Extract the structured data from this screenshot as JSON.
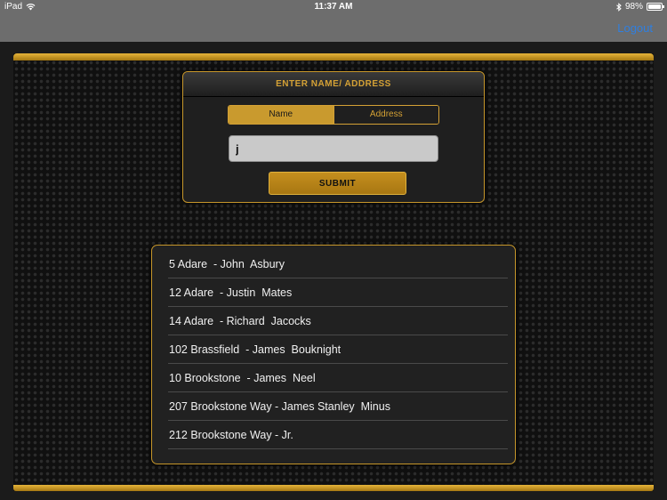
{
  "status_bar": {
    "device": "iPad",
    "time": "11:37 AM",
    "battery": "98%",
    "battery_level": 0.98,
    "icons": [
      "wifi-icon",
      "bluetooth-icon",
      "battery-icon"
    ]
  },
  "nav": {
    "logout_label": "Logout"
  },
  "form": {
    "header": "ENTER NAME/ ADDRESS",
    "tabs": [
      {
        "label": "Name",
        "selected": true
      },
      {
        "label": "Address",
        "selected": false
      }
    ],
    "input_value": "j",
    "submit_label": "SUBMIT"
  },
  "results": [
    {
      "label": "5 Adare  - John  Asbury"
    },
    {
      "label": "12 Adare  - Justin  Mates"
    },
    {
      "label": "14 Adare  - Richard  Jacocks"
    },
    {
      "label": "102 Brassfield  - James  Bouknight"
    },
    {
      "label": "10 Brookstone  - James  Neel"
    },
    {
      "label": "207 Brookstone Way - James Stanley  Minus"
    },
    {
      "label": "212 Brookstone Way - Jr."
    }
  ],
  "colors": {
    "gold": "#c99a2e",
    "link_blue": "#2f7fe0",
    "nav_gray": "#6d6d6d"
  }
}
